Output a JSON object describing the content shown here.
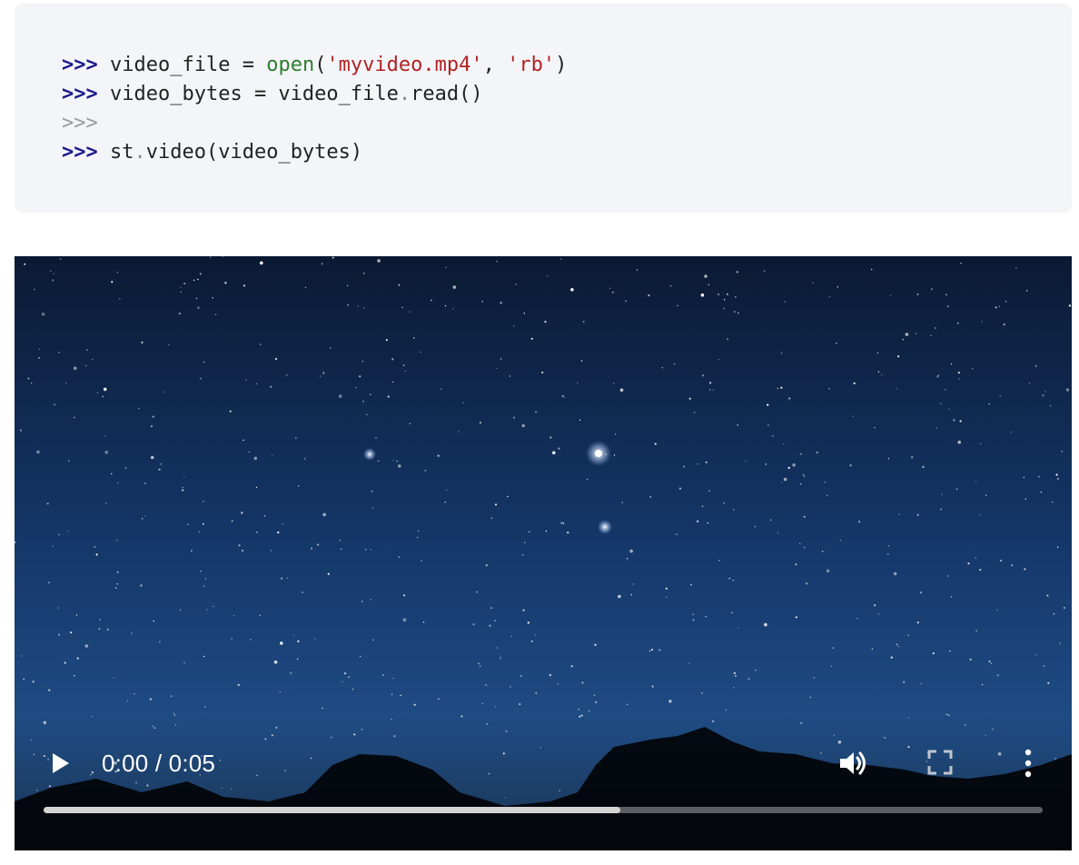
{
  "code": {
    "lines": [
      {
        "prompt": ">>>",
        "tokens": [
          {
            "t": " video_file ",
            "k": "plain"
          },
          {
            "t": "=",
            "k": "op"
          },
          {
            "t": " ",
            "k": "plain"
          },
          {
            "t": "open",
            "k": "builtin"
          },
          {
            "t": "(",
            "k": "plain"
          },
          {
            "t": "'myvideo.mp4'",
            "k": "string"
          },
          {
            "t": ", ",
            "k": "plain"
          },
          {
            "t": "'rb'",
            "k": "string"
          },
          {
            "t": ")",
            "k": "plain"
          }
        ]
      },
      {
        "prompt": ">>>",
        "tokens": [
          {
            "t": " video_bytes ",
            "k": "plain"
          },
          {
            "t": "=",
            "k": "op"
          },
          {
            "t": " video_file",
            "k": "plain"
          },
          {
            "t": ".",
            "k": "dot"
          },
          {
            "t": "read()",
            "k": "plain"
          }
        ]
      },
      {
        "prompt": ">>>",
        "dim": true,
        "tokens": []
      },
      {
        "prompt": ">>>",
        "tokens": [
          {
            "t": " st",
            "k": "plain"
          },
          {
            "t": ".",
            "k": "dot"
          },
          {
            "t": "video(video_bytes)",
            "k": "plain"
          }
        ]
      }
    ]
  },
  "video": {
    "time_display": "0:00 / 0:05",
    "progress": 0.577,
    "icons": {
      "play": "play-icon",
      "volume": "volume-icon",
      "fullscreen": "fullscreen-icon",
      "more": "more-vertical-icon"
    }
  },
  "colors": {
    "code_bg": "#f4f5f9",
    "prompt": "#1a1a8c",
    "builtin": "#2e7d2e",
    "string": "#b22222",
    "sky_top": "#0a1428",
    "sky_bottom": "#1e4f86"
  }
}
